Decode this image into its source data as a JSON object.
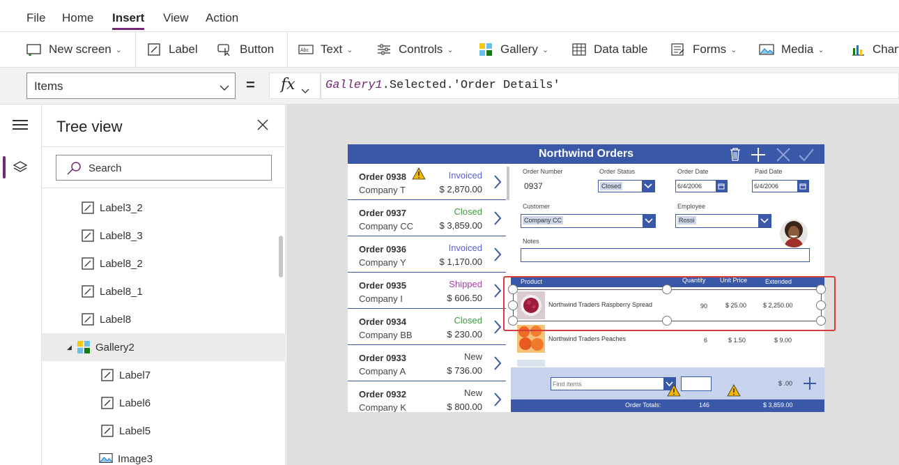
{
  "menu": {
    "file": "File",
    "home": "Home",
    "insert": "Insert",
    "view": "View",
    "action": "Action"
  },
  "ribbon": {
    "new_screen": "New screen",
    "label": "Label",
    "button": "Button",
    "text": "Text",
    "controls": "Controls",
    "gallery": "Gallery",
    "data_table": "Data table",
    "forms": "Forms",
    "media": "Media",
    "charts": "Charts"
  },
  "formula": {
    "property": "Items",
    "equals": "=",
    "fx": "fx",
    "control": "Gallery1",
    "rest": ".Selected.'Order Details'"
  },
  "tree": {
    "title": "Tree view",
    "search_placeholder": "Search",
    "items": [
      {
        "label": "Label3_2",
        "type": "label"
      },
      {
        "label": "Label8_3",
        "type": "label"
      },
      {
        "label": "Label8_2",
        "type": "label"
      },
      {
        "label": "Label8_1",
        "type": "label"
      },
      {
        "label": "Label8",
        "type": "label"
      },
      {
        "label": "Gallery2",
        "type": "gallery"
      },
      {
        "label": "Label7",
        "type": "label"
      },
      {
        "label": "Label6",
        "type": "label"
      },
      {
        "label": "Label5",
        "type": "label"
      },
      {
        "label": "Image3",
        "type": "image"
      }
    ]
  },
  "app": {
    "title": "Northwind Orders",
    "orders": [
      {
        "number": "Order 0938",
        "company": "Company T",
        "status": "Invoiced",
        "amount": "$ 2,870.00",
        "status_color": "#5a5fd1",
        "warning": true
      },
      {
        "number": "Order 0937",
        "company": "Company CC",
        "status": "Closed",
        "amount": "$ 3,859.00",
        "status_color": "#3e9b3e",
        "warning": false
      },
      {
        "number": "Order 0936",
        "company": "Company Y",
        "status": "Invoiced",
        "amount": "$ 1,170.00",
        "status_color": "#5a5fd1",
        "warning": false
      },
      {
        "number": "Order 0935",
        "company": "Company I",
        "status": "Shipped",
        "amount": "$ 606.50",
        "status_color": "#a43fa4",
        "warning": false
      },
      {
        "number": "Order 0934",
        "company": "Company BB",
        "status": "Closed",
        "amount": "$ 230.00",
        "status_color": "#3e9b3e",
        "warning": false
      },
      {
        "number": "Order 0933",
        "company": "Company A",
        "status": "New",
        "amount": "$ 736.00",
        "status_color": "#444444",
        "warning": false
      },
      {
        "number": "Order 0932",
        "company": "Company K",
        "status": "New",
        "amount": "$ 800.00",
        "status_color": "#444444",
        "warning": false
      }
    ],
    "detail": {
      "order_number_label": "Order Number",
      "order_number": "0937",
      "order_status_label": "Order Status",
      "order_status": "Closed",
      "order_date_label": "Order Date",
      "order_date": "6/4/2006",
      "paid_date_label": "Paid Date",
      "paid_date": "6/4/2006",
      "customer_label": "Customer",
      "customer": "Company CC",
      "employee_label": "Employee",
      "employee": "Rossi",
      "notes_label": "Notes"
    },
    "grid": {
      "headers": {
        "product": "Product",
        "quantity": "Quantity",
        "unit_price": "Unit Price",
        "extended": "Extended"
      },
      "rows": [
        {
          "product": "Northwind Traders Raspberry Spread",
          "quantity": "90",
          "unit_price": "$ 25.00",
          "extended": "$ 2,250.00"
        },
        {
          "product": "Northwind Traders Peaches",
          "quantity": "6",
          "unit_price": "$ 1.50",
          "extended": "$ 9.00"
        }
      ]
    },
    "footer": {
      "find_placeholder": "Find items",
      "amount": "$ .00",
      "totals_label": "Order Totals:",
      "totals_qty": "146",
      "totals_amount": "$ 3,859.00"
    }
  },
  "colors": {
    "accent": "#742774",
    "app_blue": "#3a58a8",
    "selection": "#d83b3b"
  }
}
